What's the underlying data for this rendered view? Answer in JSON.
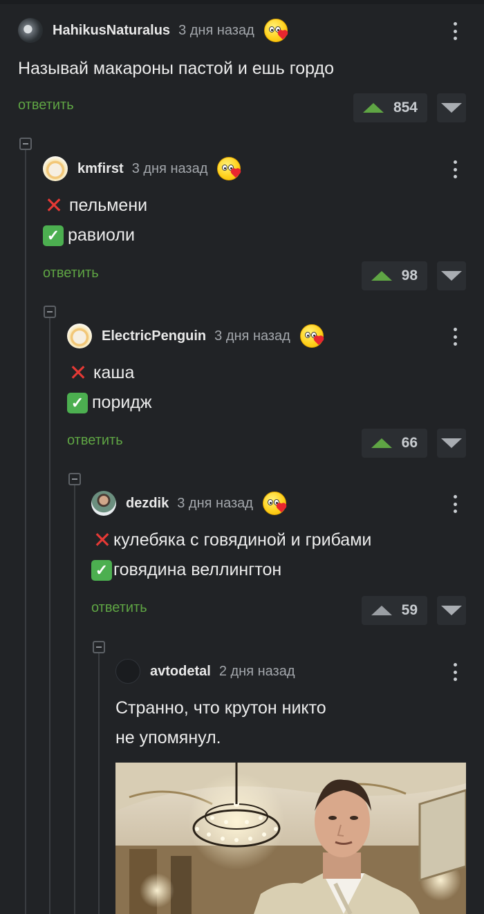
{
  "comments": [
    {
      "username": "HahikusNaturalus",
      "time": "3 дня назад",
      "lines": [
        {
          "mark": "",
          "text": "Называй макароны пастой и ешь гордо"
        }
      ],
      "reply_label": "ответить",
      "score": "854",
      "voted_up": true
    },
    {
      "username": "kmfirst",
      "time": "3 дня назад",
      "lines": [
        {
          "mark": "cross-mark",
          "text": "пельмени"
        },
        {
          "mark": "check-mark",
          "text": "равиоли"
        }
      ],
      "reply_label": "ответить",
      "score": "98",
      "voted_up": true
    },
    {
      "username": "ElectricPenguin",
      "time": "3 дня назад",
      "lines": [
        {
          "mark": "cross-mark",
          "text": "каша"
        },
        {
          "mark": "check-mark",
          "text": "поридж"
        }
      ],
      "reply_label": "ответить",
      "score": "66",
      "voted_up": true
    },
    {
      "username": "dezdik",
      "time": "3 дня назад",
      "lines": [
        {
          "mark": "cross-mark",
          "text": "кулебяка с говядиной и грибами"
        },
        {
          "mark": "check-mark",
          "text": "говядина веллингтон"
        }
      ],
      "reply_label": "ответить",
      "score": "59",
      "voted_up": false
    },
    {
      "username": "avtodetal",
      "time": "2 дня назад",
      "lines": [
        {
          "mark": "",
          "text": "Странно, что крутон никто"
        },
        {
          "mark": "",
          "text": "не упомянул."
        }
      ],
      "has_image": true
    }
  ],
  "icons": {
    "reaction": "kiss-heart-emoji-icon",
    "more": "more-vertical-icon",
    "upvote": "triangle-up-icon",
    "downvote": "triangle-down-icon",
    "collapse": "collapse-minus-icon"
  },
  "colors": {
    "background": "#212326",
    "reply_link": "#5fa544",
    "upvote_active": "#5fa544"
  }
}
